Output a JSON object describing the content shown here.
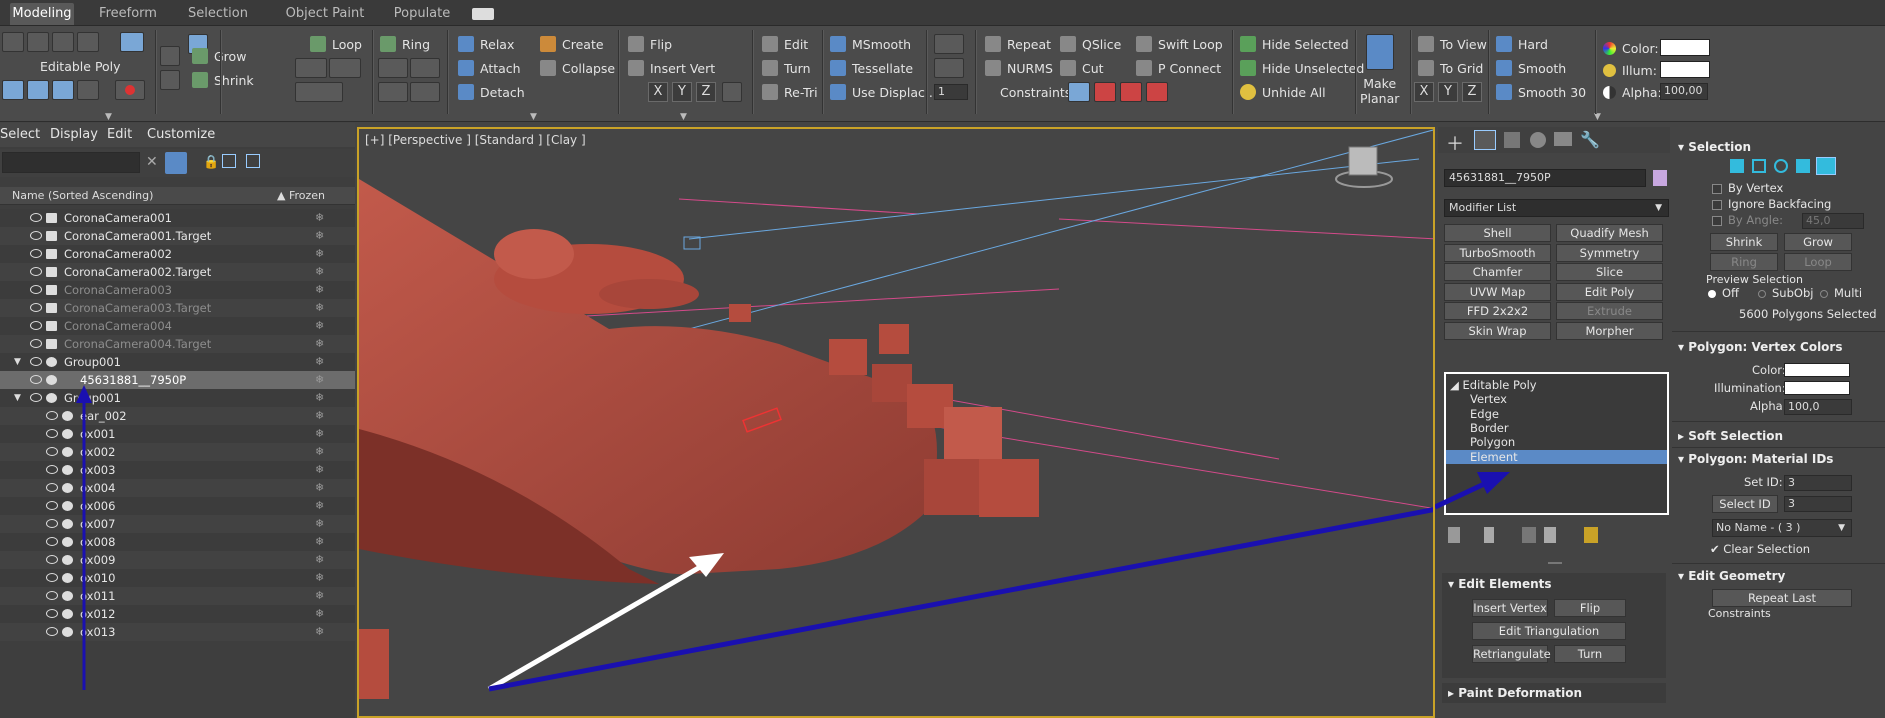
{
  "tabs": [
    "Modeling",
    "Freeform",
    "Selection",
    "Object Paint",
    "Populate"
  ],
  "ribbon": {
    "editable_poly": "Editable Poly",
    "grow": "Grow",
    "shrink": "Shrink",
    "loop": "Loop",
    "ring": "Ring",
    "relax": "Relax",
    "create": "Create",
    "attach": "Attach",
    "collapse": "Collapse",
    "detach": "Detach",
    "flip": "Flip",
    "insert_vert": "Insert Vert",
    "edit": "Edit",
    "turn": "Turn",
    "retri": "Re-Tri",
    "msmooth": "MSmooth",
    "tessellate": "Tessellate",
    "use_displac": "Use Displac...",
    "spinner_val": "1",
    "repeat": "Repeat",
    "qslice": "QSlice",
    "swift_loop": "Swift Loop",
    "nurms": "NURMS",
    "cut": "Cut",
    "p_connect": "P Connect",
    "constraints": "Constraints:",
    "hide_selected": "Hide Selected",
    "hide_unselected": "Hide Unselected",
    "unhide_all": "Unhide All",
    "make_planar": "Make\nPlanar",
    "to_view": "To View",
    "to_grid": "To Grid",
    "x": "X",
    "y": "Y",
    "z": "Z",
    "hard": "Hard",
    "smooth": "Smooth",
    "smooth30": "Smooth 30",
    "color": "Color:",
    "illum": "Illum:",
    "alpha": "Alpha:",
    "alpha_val": "100,00"
  },
  "explorer": {
    "menu": [
      "Select",
      "Display",
      "Edit",
      "Customize"
    ],
    "col_name": "Name (Sorted Ascending)",
    "col_frozen": "▲ Frozen",
    "rows": [
      {
        "name": "CoronaCamera001",
        "dim": false
      },
      {
        "name": "CoronaCamera001.Target",
        "dim": false
      },
      {
        "name": "CoronaCamera002",
        "dim": false
      },
      {
        "name": "CoronaCamera002.Target",
        "dim": false
      },
      {
        "name": "CoronaCamera003",
        "dim": true
      },
      {
        "name": "CoronaCamera003.Target",
        "dim": true
      },
      {
        "name": "CoronaCamera004",
        "dim": true
      },
      {
        "name": "CoronaCamera004.Target",
        "dim": true
      },
      {
        "name": "Group001",
        "dim": false
      },
      {
        "name": "45631881__7950P",
        "dim": false
      },
      {
        "name": "Group001",
        "dim": false
      },
      {
        "name": "ear_002",
        "dim": false
      },
      {
        "name": "ox001",
        "dim": false
      },
      {
        "name": "ox002",
        "dim": false
      },
      {
        "name": "ox003",
        "dim": false
      },
      {
        "name": "ox004",
        "dim": false
      },
      {
        "name": "ox006",
        "dim": false
      },
      {
        "name": "ox007",
        "dim": false
      },
      {
        "name": "ox008",
        "dim": false
      },
      {
        "name": "ox009",
        "dim": false
      },
      {
        "name": "ox010",
        "dim": false
      },
      {
        "name": "ox011",
        "dim": false
      },
      {
        "name": "ox012",
        "dim": false
      },
      {
        "name": "ox013",
        "dim": false
      }
    ]
  },
  "viewport": {
    "label": "[+] [Perspective ] [Standard ] [Clay ]"
  },
  "cmd": {
    "object_name": "45631881__7950P",
    "modifier_list": "Modifier List",
    "buttons": [
      "Shell",
      "Quadify Mesh",
      "TurboSmooth",
      "Symmetry",
      "Chamfer",
      "Slice",
      "UVW Map",
      "Edit Poly",
      "FFD 2x2x2",
      "Extrude",
      "Skin Wrap",
      "Morpher"
    ],
    "stack": [
      "Editable Poly",
      "Vertex",
      "Edge",
      "Border",
      "Polygon",
      "Element"
    ],
    "edit_elements": "Edit Elements",
    "insert_vertex": "Insert Vertex",
    "flip": "Flip",
    "edit_triangulation": "Edit Triangulation",
    "retriangulate": "Retriangulate",
    "turn": "Turn",
    "paint_deformation": "Paint Deformation"
  },
  "right": {
    "selection": "Selection",
    "by_vertex": "By Vertex",
    "ignore_backfacing": "Ignore Backfacing",
    "by_angle": "By Angle:",
    "by_angle_val": "45,0",
    "shrink": "Shrink",
    "grow": "Grow",
    "ring": "Ring",
    "loop": "Loop",
    "preview_selection": "Preview Selection",
    "off": "Off",
    "subobj": "SubObj",
    "multi": "Multi",
    "selected_count": "5600 Polygons Selected",
    "vertex_colors": "Polygon: Vertex Colors",
    "color": "Color:",
    "illumination": "Illumination:",
    "alpha": "Alpha:",
    "alpha_val": "100,0",
    "soft_selection": "Soft Selection",
    "material_ids": "Polygon: Material IDs",
    "set_id": "Set ID:",
    "set_id_val": "3",
    "select_id": "Select ID",
    "select_id_val": "3",
    "no_name": "No Name - ( 3 )",
    "clear_selection": "Clear Selection",
    "edit_geometry": "Edit Geometry",
    "repeat_last": "Repeat Last",
    "constraints": "Constraints"
  }
}
